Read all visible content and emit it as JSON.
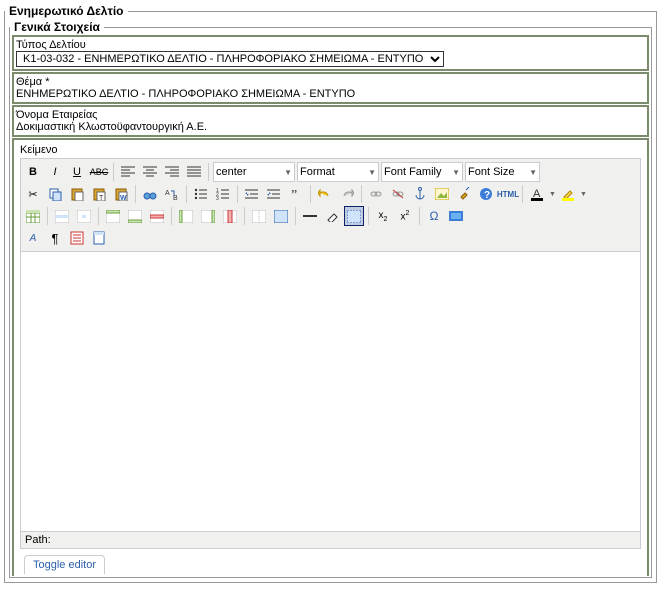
{
  "outer": {
    "legend": "Ενημερωτικό Δελτίο"
  },
  "inner": {
    "legend": "Γενικά Στοιχεία"
  },
  "typeField": {
    "label": "Τύπος Δελτίου",
    "value": "Κ1-03-032 - ΕΝΗΜΕΡΩΤΙΚΟ ΔΕΛΤΙΟ - ΠΛΗΡΟΦΟΡΙΑΚΟ ΣΗΜΕΙΩΜΑ - ΕΝΤΥΠΟ"
  },
  "subjectField": {
    "label": "Θέμα *",
    "value": "ΕΝΗΜΕΡΩΤΙΚΟ ΔΕΛΤΙΟ - ΠΛΗΡΟΦΟΡΙΑΚΟ ΣΗΜΕΙΩΜΑ - ΕΝΤΥΠΟ"
  },
  "companyField": {
    "label": "Όνομα Εταιρείας",
    "value": "Δοκιμαστική Κλωστοϋφαντουργική Α.Ε."
  },
  "textField": {
    "label": "Κείμενο"
  },
  "toolbar": {
    "alignSelectValue": "center",
    "formatSelect": "Format",
    "fontFamilySelect": "Font Family",
    "fontSizeSelect": "Font Size"
  },
  "pathLabel": "Path:",
  "toggle": "Toggle editor"
}
